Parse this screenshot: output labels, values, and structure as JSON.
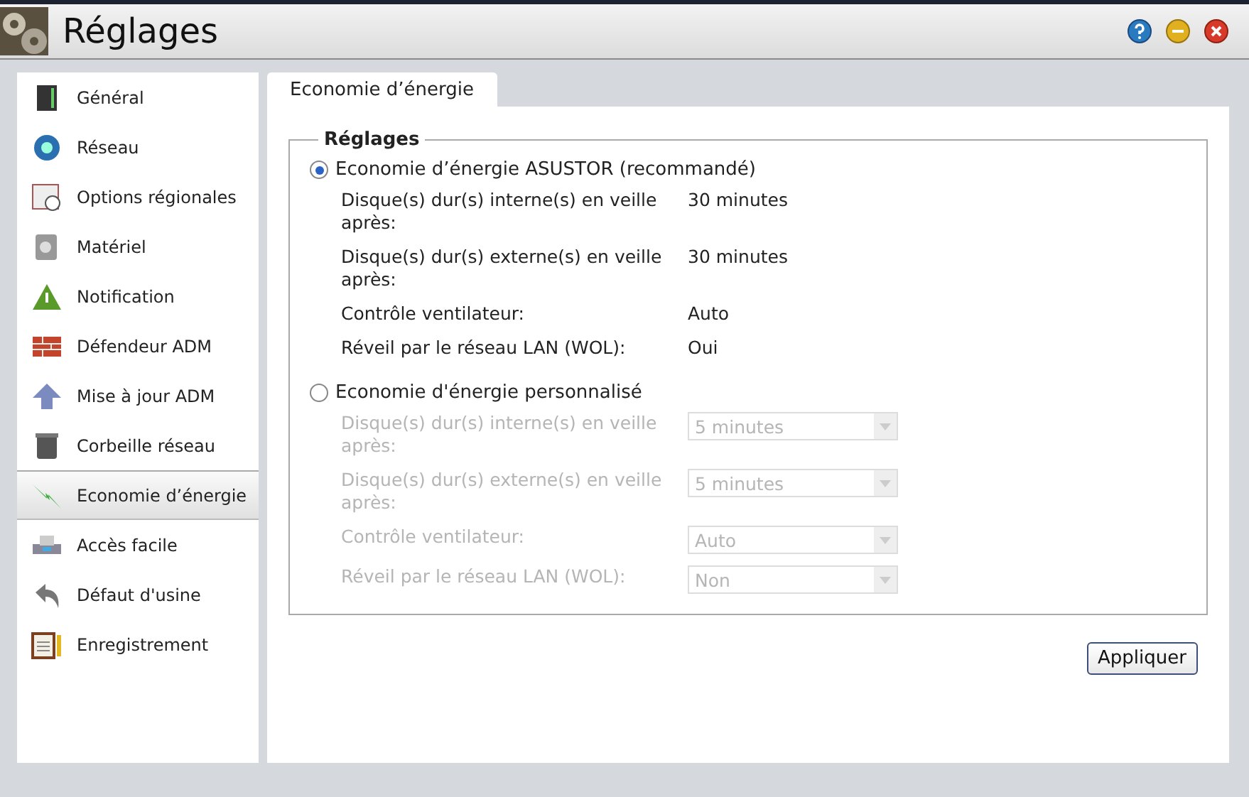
{
  "window": {
    "title": "Réglages"
  },
  "sidebar": {
    "items": [
      {
        "label": "Général",
        "selected": false
      },
      {
        "label": "Réseau",
        "selected": false
      },
      {
        "label": "Options régionales",
        "selected": false
      },
      {
        "label": "Matériel",
        "selected": false
      },
      {
        "label": "Notification",
        "selected": false
      },
      {
        "label": "Défendeur ADM",
        "selected": false
      },
      {
        "label": "Mise à jour ADM",
        "selected": false
      },
      {
        "label": "Corbeille réseau",
        "selected": false
      },
      {
        "label": "Economie d’énergie",
        "selected": true
      },
      {
        "label": "Accès facile",
        "selected": false
      },
      {
        "label": "Défaut d'usine",
        "selected": false
      },
      {
        "label": "Enregistrement",
        "selected": false
      }
    ]
  },
  "tabs": [
    {
      "label": "Economie d’énergie",
      "selected": true
    }
  ],
  "group": {
    "title": "Réglages",
    "options": [
      {
        "label": "Economie d’énergie ASUSTOR (recommandé)",
        "selected": true,
        "disabled": false,
        "settings": [
          {
            "kind": "text",
            "label": "Disque(s) dur(s) interne(s) en veille après:",
            "value": "30 minutes"
          },
          {
            "kind": "text",
            "label": "Disque(s) dur(s) externe(s) en veille après:",
            "value": "30 minutes"
          },
          {
            "kind": "text",
            "label": "Contrôle ventilateur:",
            "value": "Auto"
          },
          {
            "kind": "text",
            "label": "Réveil par le réseau LAN (WOL):",
            "value": "Oui"
          }
        ]
      },
      {
        "label": "Economie d'énergie personnalisé",
        "selected": false,
        "disabled": true,
        "settings": [
          {
            "kind": "select",
            "label": "Disque(s) dur(s) interne(s) en veille après:",
            "value": "5 minutes"
          },
          {
            "kind": "select",
            "label": "Disque(s) dur(s) externe(s) en veille après:",
            "value": "5 minutes"
          },
          {
            "kind": "select",
            "label": "Contrôle ventilateur:",
            "value": "Auto"
          },
          {
            "kind": "select",
            "label": "Réveil par le réseau LAN (WOL):",
            "value": "Non"
          }
        ]
      }
    ]
  },
  "apply_button": "Appliquer"
}
